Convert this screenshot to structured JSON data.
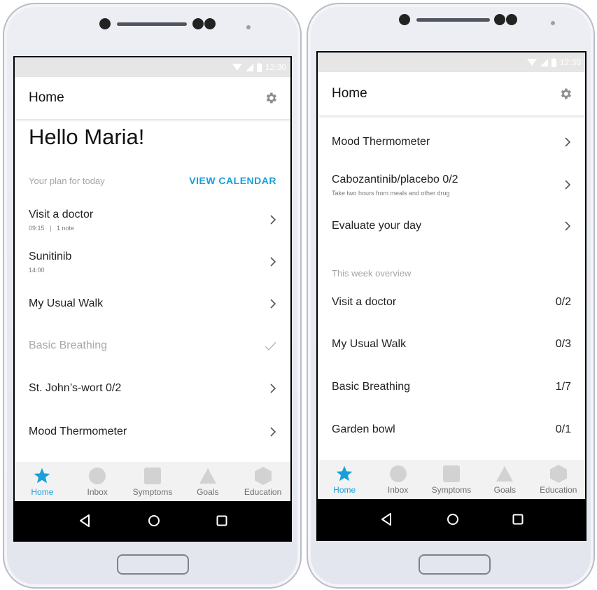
{
  "colors": {
    "accent": "#1a9fd9",
    "inactive_icon": "#d2d2d2",
    "subtle_text": "#a5a5a5"
  },
  "left": {
    "status_time": "12:30",
    "app_title": "Home",
    "greeting": "Hello Maria!",
    "section_label": "Your plan for today",
    "view_calendar": "VIEW CALENDAR",
    "items": [
      {
        "title": "Visit a doctor",
        "time": "09:15",
        "separator": "|",
        "note": "1 note",
        "icon": "chevron-right"
      },
      {
        "title": "Sunitinib",
        "sub": "14:00",
        "icon": "chevron-right"
      },
      {
        "title": "My Usual Walk",
        "icon": "chevron-right"
      },
      {
        "title": "Basic Breathing",
        "icon": "check",
        "completed": true
      },
      {
        "title": "St. John’s-wort 0/2",
        "icon": "chevron-right"
      },
      {
        "title": "Mood Thermometer",
        "icon": "chevron-right"
      }
    ]
  },
  "right": {
    "status_time": "12:30",
    "app_title": "Home",
    "items": [
      {
        "title": "Mood Thermometer",
        "icon": "chevron-right"
      },
      {
        "title": "Cabozantinib/placebo 0/2",
        "sub": "Take two hours from meals and other drug",
        "icon": "chevron-right"
      },
      {
        "title": "Evaluate your day",
        "icon": "chevron-right"
      }
    ],
    "week_label": "This week overview",
    "week_items": [
      {
        "title": "Visit a doctor",
        "count": "0/2"
      },
      {
        "title": "My Usual Walk",
        "count": "0/3"
      },
      {
        "title": "Basic Breathing",
        "count": "1/7"
      },
      {
        "title": "Garden bowl",
        "count": "0/1"
      }
    ]
  },
  "bottom_nav": [
    {
      "label": "Home",
      "icon": "star-icon",
      "active": true
    },
    {
      "label": "Inbox",
      "icon": "circle-icon",
      "active": false
    },
    {
      "label": "Symptoms",
      "icon": "square-icon",
      "active": false
    },
    {
      "label": "Goals",
      "icon": "triangle-icon",
      "active": false
    },
    {
      "label": "Education",
      "icon": "hexagon-icon",
      "active": false
    }
  ],
  "system_nav": [
    "back-icon",
    "home-icon",
    "recents-icon"
  ]
}
